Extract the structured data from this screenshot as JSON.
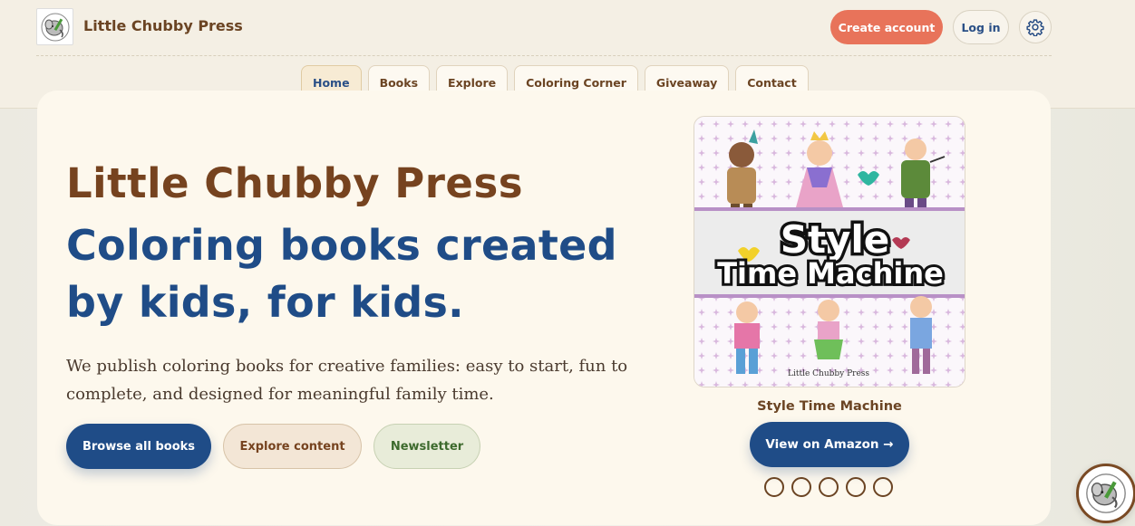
{
  "header": {
    "brand": "Little Chubby Press",
    "create_account": "Create account",
    "log_in": "Log in"
  },
  "nav": {
    "items": [
      {
        "label": "Home",
        "active": true
      },
      {
        "label": "Books"
      },
      {
        "label": "Explore"
      },
      {
        "label": "Coloring Corner"
      },
      {
        "label": "Giveaway"
      },
      {
        "label": "Contact"
      }
    ]
  },
  "hero": {
    "title": "Little Chubby Press",
    "tagline": "Coloring books created by kids, for kids.",
    "description": "We publish coloring books for creative families: easy to start, fun to complete, and designed for meaningful family time.",
    "buttons": {
      "browse": "Browse all books",
      "explore": "Explore content",
      "newsletter": "Newsletter"
    }
  },
  "featured_book": {
    "cover_title_line1": "Style",
    "cover_title_line2": "Time Machine",
    "cover_publisher": "Little Chubby Press",
    "title": "Style Time Machine",
    "cta": "View on Amazon →",
    "carousel_dots": 5
  },
  "colors": {
    "brand_brown": "#6b4423",
    "brand_blue": "#1f4c87",
    "accent_coral": "#e8735a"
  }
}
